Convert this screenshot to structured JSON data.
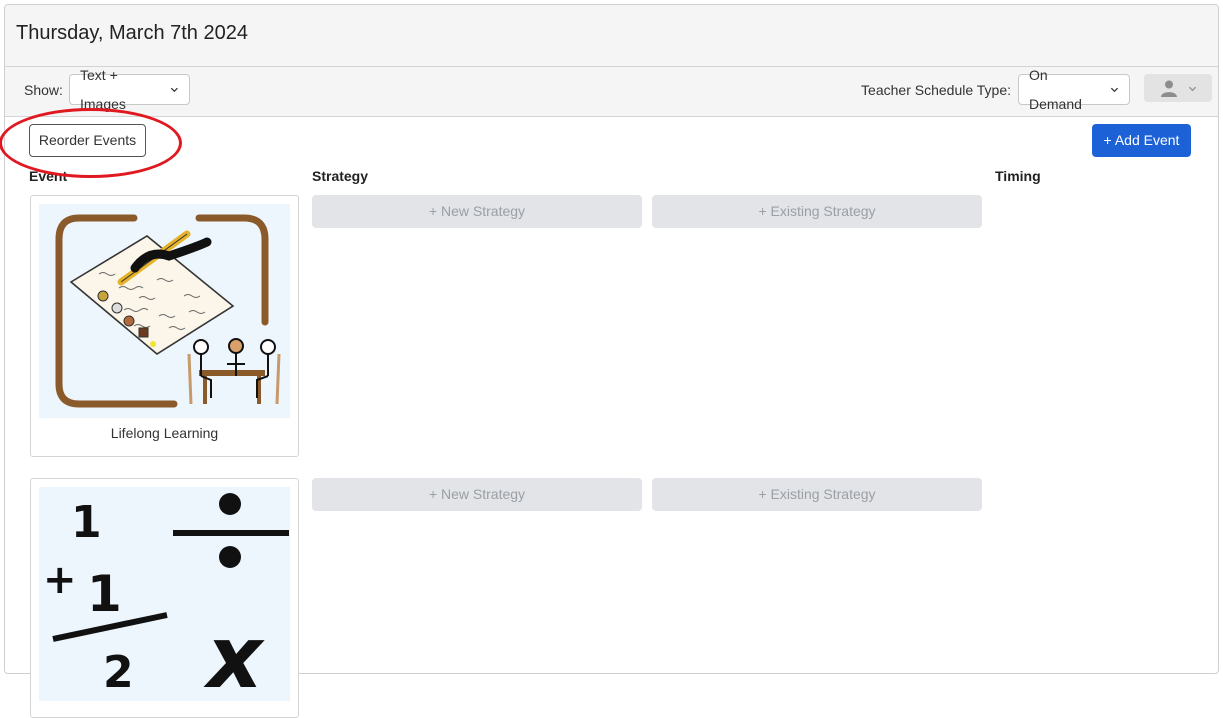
{
  "header": {
    "date": "Thursday, March 7th 2024"
  },
  "toolbar": {
    "show_label": "Show:",
    "show_value": "Text + Images",
    "schedule_label": "Teacher Schedule Type:",
    "schedule_value": "On Demand"
  },
  "actions": {
    "reorder_label": "Reorder Events",
    "add_event_label": "+ Add Event"
  },
  "columns": {
    "event": "Event",
    "strategy": "Strategy",
    "timing": "Timing"
  },
  "events": [
    {
      "label": "Lifelong Learning",
      "icon": "lifelong-learning-picture",
      "new_strategy": "+ New Strategy",
      "existing_strategy": "+ Existing Strategy"
    },
    {
      "label": "",
      "icon": "math-picture",
      "new_strategy": "+ New Strategy",
      "existing_strategy": "+ Existing Strategy"
    }
  ],
  "colors": {
    "accent": "#1c62d6",
    "annotation": "#e0181f",
    "disabled_bg": "#e2e4e7"
  }
}
